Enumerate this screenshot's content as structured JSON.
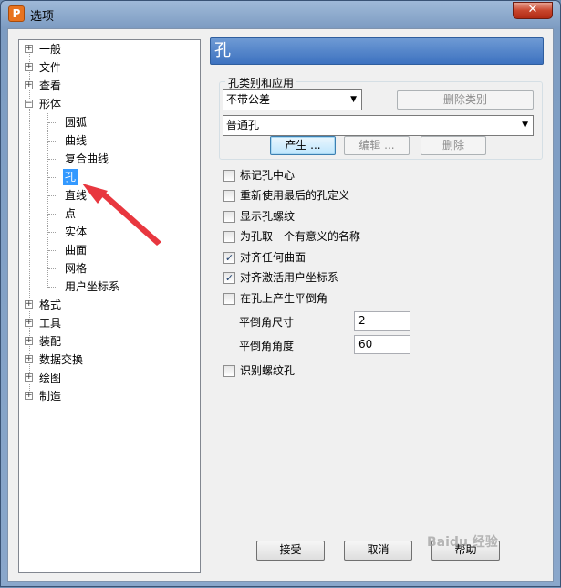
{
  "window": {
    "title": "选项",
    "close_glyph": "✕",
    "app_icon_letter": "P"
  },
  "tree": {
    "items": [
      {
        "label": "一般",
        "expander": "+"
      },
      {
        "label": "文件",
        "expander": "+"
      },
      {
        "label": "查看",
        "expander": "+"
      },
      {
        "label": "形体",
        "expander": "−"
      },
      {
        "label": "圆弧"
      },
      {
        "label": "曲线"
      },
      {
        "label": "复合曲线"
      },
      {
        "label": "孔",
        "selected": true
      },
      {
        "label": "直线"
      },
      {
        "label": "点"
      },
      {
        "label": "实体"
      },
      {
        "label": "曲面"
      },
      {
        "label": "网格"
      },
      {
        "label": "用户坐标系"
      },
      {
        "label": "格式",
        "expander": "+"
      },
      {
        "label": "工具",
        "expander": "+"
      },
      {
        "label": "装配",
        "expander": "+"
      },
      {
        "label": "数据交换",
        "expander": "+"
      },
      {
        "label": "绘图",
        "expander": "+"
      },
      {
        "label": "制造",
        "expander": "+"
      }
    ]
  },
  "panel": {
    "title": "孔",
    "group": {
      "label": "孔类别和应用",
      "category_select": "不带公差",
      "delete_category_button": "删除类别",
      "application_select": "普通孔",
      "create_button": "产生 ...",
      "edit_button": "编辑 ...",
      "delete_button": "删除"
    },
    "options": [
      {
        "label": "标记孔中心",
        "checked": false
      },
      {
        "label": "重新使用最后的孔定义",
        "checked": false
      },
      {
        "label": "显示孔螺纹",
        "checked": false
      },
      {
        "label": "为孔取一个有意义的名称",
        "checked": false
      },
      {
        "label": "对齐任何曲面",
        "checked": true
      },
      {
        "label": "对齐激活用户坐标系",
        "checked": true
      },
      {
        "label": "在孔上产生平倒角",
        "checked": false
      }
    ],
    "chamfer_size_label": "平倒角尺寸",
    "chamfer_size_value": "2",
    "chamfer_angle_label": "平倒角角度",
    "chamfer_angle_value": "60",
    "thread_hole": {
      "label": "识别螺纹孔",
      "checked": false
    }
  },
  "footer": {
    "accept_button": "接受",
    "cancel_button": "取消",
    "help_button": "帮助"
  },
  "watermark": "Baidu 经验",
  "colors": {
    "selection": "#3399ff",
    "header": "#3d72c0",
    "annotation_arrow": "#e8373f"
  },
  "icons": {
    "check": "✓",
    "dropdown": "▼"
  }
}
